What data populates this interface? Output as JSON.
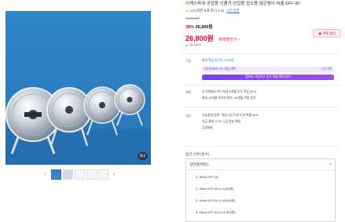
{
  "gallery": {
    "zoom_label": "확대",
    "prev_arrow": "‹",
    "next_arrow": "›"
  },
  "product": {
    "title": "이엑스파워 공업용 선풍기 산업용 업소용 앉은뱅이 써큘 EFF-30",
    "rating": "4.5",
    "review_text": "(리뷰 6개 후기 4.5)",
    "review_link": "2건 리뷰",
    "original_price": "43,000원",
    "discount_pct": "38%",
    "sale_price": "26,900원",
    "final_price": "26,800원",
    "max_benefit": "최대할인가 ~",
    "coupon_label": "쿠폰 받기",
    "seller": "LL 위크하우"
  },
  "benefits": {
    "label": "적립",
    "text": "최대 적립 포인트 2,818원",
    "card_light_left": "네이버페이 5% 적립 혜택",
    "card_light_right": "1,073원",
    "card_dark": "멤버십 가입하고 추가 적립 혜택 받기"
  },
  "card": {
    "label": "혜택",
    "line1": "무이자할부 카드 최대 5개월 추가 적립 (5%)",
    "line2": "최대 10개월 무이자 할부 ·60개월 적용 받기"
  },
  "delivery": {
    "label": "배송",
    "line1": "오늘출발 등록 · 평균 2일 이내 도착 확률 85%",
    "line2": "지금 결제 시 6/7 (금) 발송 예정",
    "line3": "무료배송"
  },
  "options": {
    "label": "옵션 선택 (필수)",
    "selected": "일반형(택일)",
    "chevron": "˄",
    "items": [
      "1. 30cm EFF-30",
      "2. 35cm EFF-35 (+4,000원)",
      "3. 40cm EFF-40 (+16,500원)",
      "4. 45cm EFF-45 (+21,800원)"
    ]
  },
  "colors": {
    "accent_red": "#e0003a",
    "link_blue": "#2d6fdd",
    "purple": "#7b3ff2",
    "image_bg": "#2a7cc0"
  }
}
